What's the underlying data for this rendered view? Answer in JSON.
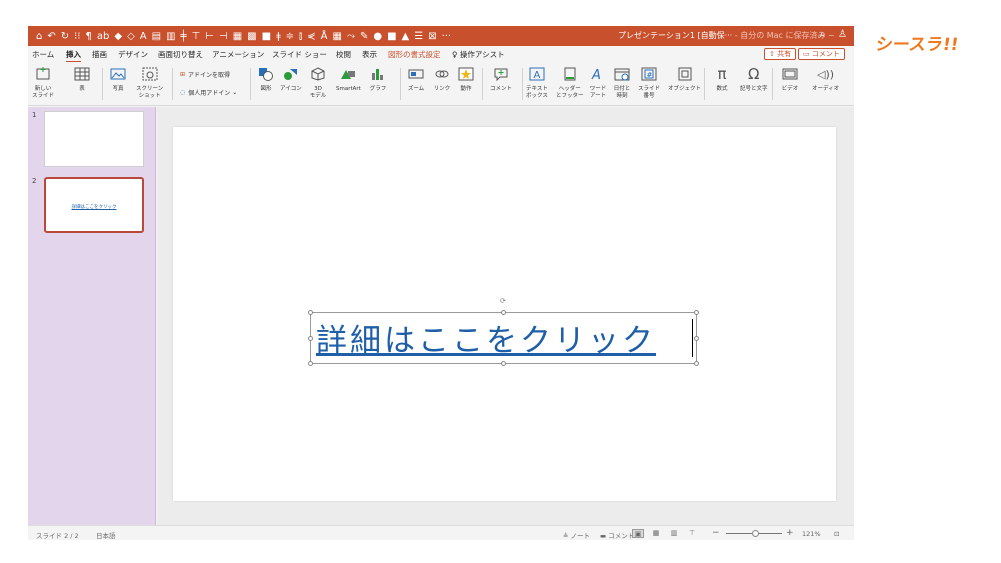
{
  "brand": {
    "logo_text": "シースラ!!",
    "color": "#f0781e"
  },
  "colors": {
    "title_bar": "#c8502d",
    "thumb_pane": "#e3d5ec",
    "hyperlink": "#1f5fa8",
    "selected_thumb_border": "#b9473a"
  },
  "title_bar": {
    "quick_access_icons": [
      "home-icon",
      "undo-icon",
      "redo-icon",
      "format-icons"
    ],
    "ab_label": "ab",
    "document_title": "プレゼンテーション1 [自動保···",
    "save_status": "- 自分の Mac に保存済み ~",
    "search_icon": "search-icon",
    "share_icon": "person-icon"
  },
  "tabs": [
    {
      "label": "ホーム"
    },
    {
      "label": "挿入",
      "active": true
    },
    {
      "label": "描画"
    },
    {
      "label": "デザイン"
    },
    {
      "label": "画面切り替え"
    },
    {
      "label": "アニメーション"
    },
    {
      "label": "スライド ショー"
    },
    {
      "label": "校閲"
    },
    {
      "label": "表示"
    },
    {
      "label": "図形の書式設定",
      "contextual": true
    }
  ],
  "tell_me": "操作アシスト",
  "share_button": "共有",
  "comment_button": "コメント",
  "ribbon": {
    "new_slide": "新しい\nスライド",
    "table": "表",
    "photo": "写真",
    "screenshot": "スクリーン\nショット",
    "get_addins": "アドインを取得",
    "my_addins": "個人用アドイン",
    "shapes": "図形",
    "icons": "アイコン",
    "models_3d": "3D\nモデル",
    "smartart": "SmartArt",
    "chart": "グラフ",
    "zoom": "ズーム",
    "link": "リンク",
    "action": "動作",
    "comment": "コメント",
    "text_box": "テキスト\nボックス",
    "header_footer": "ヘッダー\nとフッター",
    "wordart": "ワード\nアート",
    "date_time": "日付と\n時刻",
    "slide_number": "スライド\n番号",
    "object": "オブジェクト",
    "equation": "数式",
    "symbol": "記号と文字",
    "video": "ビデオ",
    "audio": "オーディオ"
  },
  "slides": [
    {
      "number": "1",
      "text": ""
    },
    {
      "number": "2",
      "text": "詳細はここをクリック",
      "selected": true
    }
  ],
  "slide_content": {
    "hyperlink_text": "詳細はここをクリック"
  },
  "status_bar": {
    "slide_info": "スライド 2 / 2",
    "language": "日本語",
    "notes": "ノート",
    "comments": "コメント",
    "zoom_level": "121%"
  }
}
